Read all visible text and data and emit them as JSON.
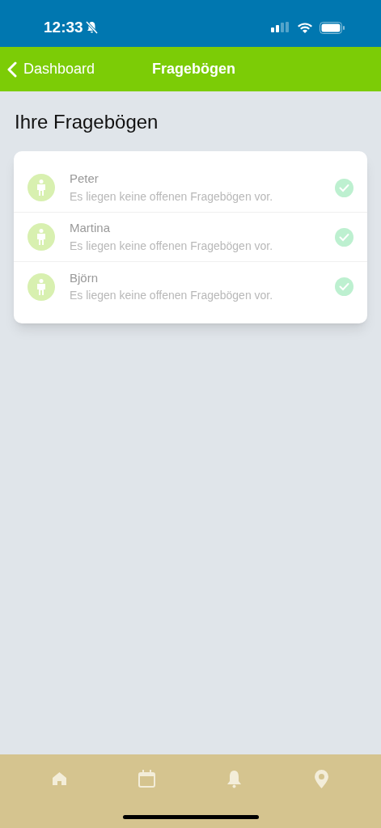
{
  "status_bar": {
    "time": "12:33",
    "silent": true
  },
  "nav": {
    "back": "Dashboard",
    "title": "Fragebögen"
  },
  "heading": "Ihre Fragebögen",
  "people": [
    {
      "name": "Peter",
      "message": "Es liegen keine offenen Fragebögen vor.",
      "done": true
    },
    {
      "name": "Martina",
      "message": "Es liegen keine offenen Fragebögen vor.",
      "done": true
    },
    {
      "name": "Björn",
      "message": "Es liegen keine offenen Fragebögen vor.",
      "done": true
    }
  ],
  "tab_bar": [
    {
      "kind": "home"
    },
    {
      "kind": "calendar"
    },
    {
      "kind": "bell"
    },
    {
      "kind": "pin"
    }
  ]
}
